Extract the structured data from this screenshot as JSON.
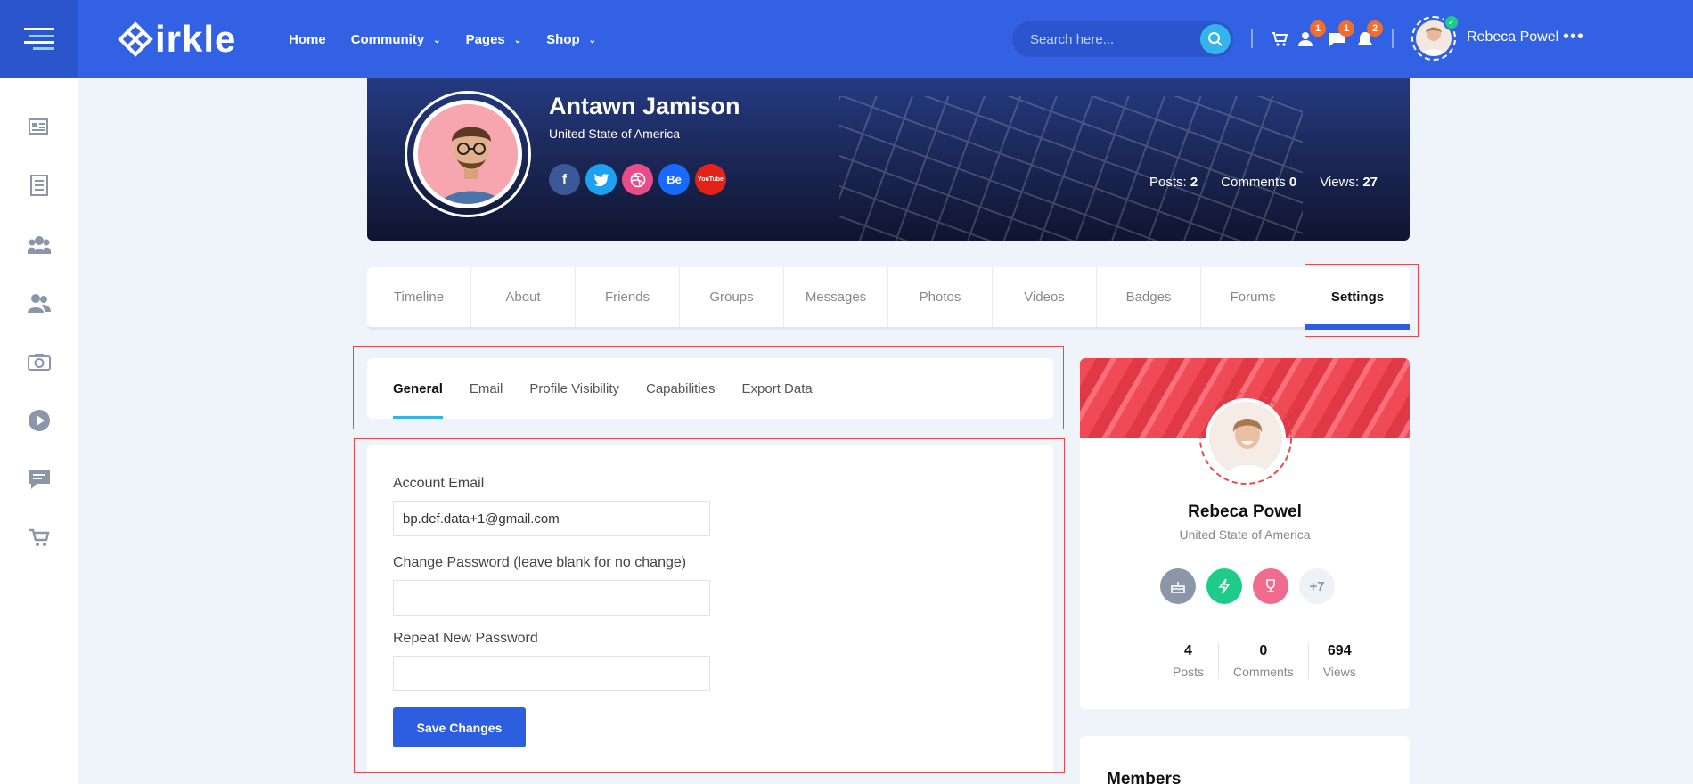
{
  "brand": {
    "logo_text": "irkle"
  },
  "nav": [
    {
      "label": "Home",
      "dropdown": false
    },
    {
      "label": "Community",
      "dropdown": true
    },
    {
      "label": "Pages",
      "dropdown": true
    },
    {
      "label": "Shop",
      "dropdown": true
    }
  ],
  "search": {
    "placeholder": "Search here..."
  },
  "notifications": {
    "friends": "1",
    "messages": "1",
    "alerts": "2"
  },
  "current_user": {
    "name": "Rebeca Powel"
  },
  "profile": {
    "name": "Antawn Jamison",
    "location": "United State of America",
    "socials": [
      "f",
      "t",
      "d",
      "Bē",
      "YouTube"
    ],
    "stats": {
      "posts_label": "Posts:",
      "posts": "2",
      "comments_label": "Comments",
      "comments": "0",
      "views_label": "Views:",
      "views": "27"
    }
  },
  "tabs": [
    "Timeline",
    "About",
    "Friends",
    "Groups",
    "Messages",
    "Photos",
    "Videos",
    "Badges",
    "Forums",
    "Settings"
  ],
  "active_tab": "Settings",
  "subtabs": [
    "General",
    "Email",
    "Profile Visibility",
    "Capabilities",
    "Export Data"
  ],
  "active_subtab": "General",
  "form": {
    "email_label": "Account Email",
    "email_value": "bp.def.data+1@gmail.com",
    "password_label": "Change Password (leave blank for no change)",
    "password_value": "",
    "repeat_label": "Repeat New Password",
    "repeat_value": "",
    "save_label": "Save Changes"
  },
  "user_card": {
    "name": "Rebeca Powel",
    "location": "United State of America",
    "badge_more": "+7",
    "stats": [
      {
        "value": "4",
        "label": "Posts"
      },
      {
        "value": "0",
        "label": "Comments"
      },
      {
        "value": "694",
        "label": "Views"
      }
    ]
  },
  "members": {
    "title": "Members"
  },
  "colors": {
    "primary": "#3262e3",
    "accent": "#35b4ea",
    "highlight": "#e8484e"
  }
}
